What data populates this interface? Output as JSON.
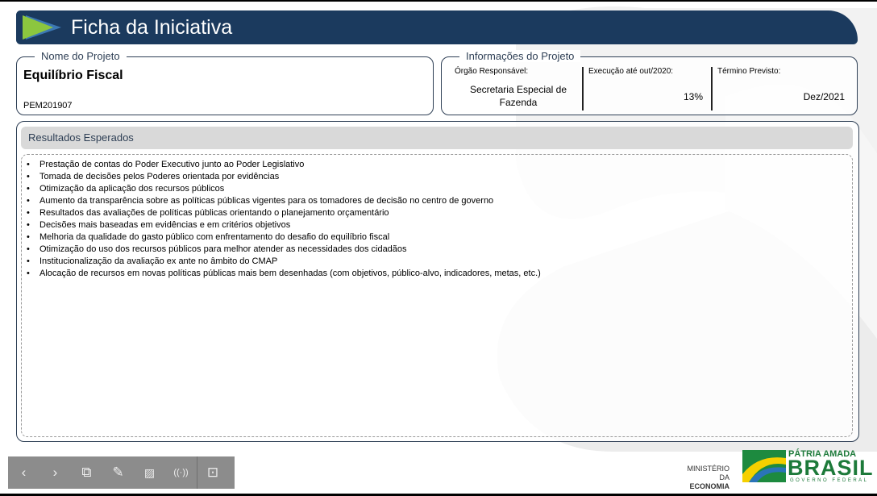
{
  "header": {
    "title": "Ficha da Iniciativa"
  },
  "projeto": {
    "legend": "Nome do Projeto",
    "name": "Equilíbrio Fiscal",
    "code": "PEM201907"
  },
  "info": {
    "legend": "Informações do Projeto",
    "orgao_label": "Órgão Responsável:",
    "orgao_value": "Secretaria Especial de Fazenda",
    "execucao_label": "Execução até out/2020:",
    "execucao_value": "13%",
    "termino_label": "Término Previsto:",
    "termino_value": "Dez/2021"
  },
  "resultados": {
    "title": "Resultados Esperados",
    "items": [
      "Prestação de contas do Poder Executivo junto ao Poder Legislativo",
      "Tomada de decisões pelos Poderes orientada por evidências",
      "Otimização da aplicação dos recursos públicos",
      "Aumento da transparência sobre as políticas públicas vigentes para os tomadores de decisão no centro de governo",
      "Resultados das avaliações de políticas públicas orientando o planejamento orçamentário",
      "Decisões mais baseadas em evidências e em critérios objetivos",
      "Melhoria da qualidade do gasto público com enfrentamento do desafio do equilíbrio fiscal",
      "Otimização do uso dos recursos públicos para melhor atender as necessidades dos cidadãos",
      "Institucionalização da avaliação ex ante no âmbito do CMAP",
      "Alocação de recursos em novas políticas públicas mais bem desenhadas (com objetivos, público-alvo, indicadores, metas, etc.)"
    ]
  },
  "toolbar": {
    "prev": "‹",
    "next": "›",
    "pages": "⧉",
    "pen": "✎",
    "notes": "▨",
    "broadcast": "((·))",
    "present": "⊡"
  },
  "footer": {
    "ministerio": "MINISTÉRIO DA",
    "economia": "ECONOMIA",
    "patria": "PÁTRIA AMADA",
    "brasil": "BRASIL",
    "governo": "GOVERNO FEDERAL"
  },
  "colors": {
    "header": "#1b3a5e",
    "accent_green": "#8cc63f",
    "brand_green": "#1d7a3a"
  }
}
